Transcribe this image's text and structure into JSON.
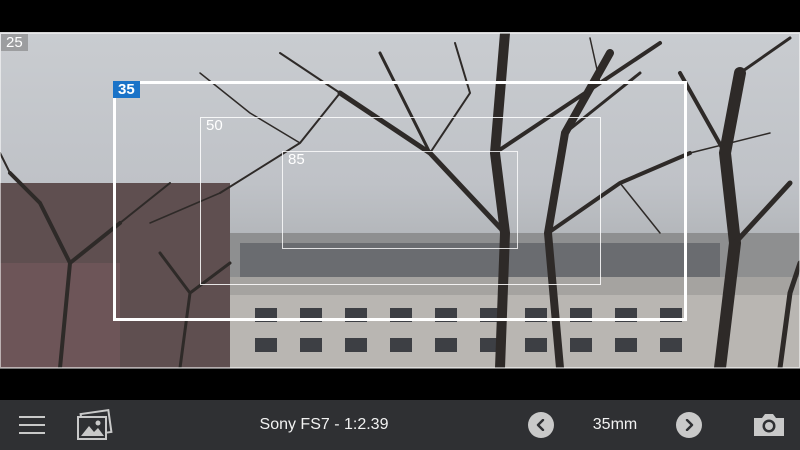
{
  "frame_lines": [
    {
      "label": "25",
      "selected": false
    },
    {
      "label": "35",
      "selected": true
    },
    {
      "label": "50",
      "selected": false
    },
    {
      "label": "85",
      "selected": false
    }
  ],
  "toolbar": {
    "camera_format": "Sony FS7 - 1:2.39",
    "focal_length": "35mm",
    "icons": {
      "menu": "hamburger-menu-icon",
      "gallery": "gallery-icon",
      "previous": "chevron-left-icon",
      "next": "chevron-right-icon",
      "capture": "camera-icon"
    }
  },
  "colors": {
    "selected_label_bg": "#1a73c8",
    "toolbar_bg": "#2f3033",
    "frame_line": "#ffffff"
  }
}
